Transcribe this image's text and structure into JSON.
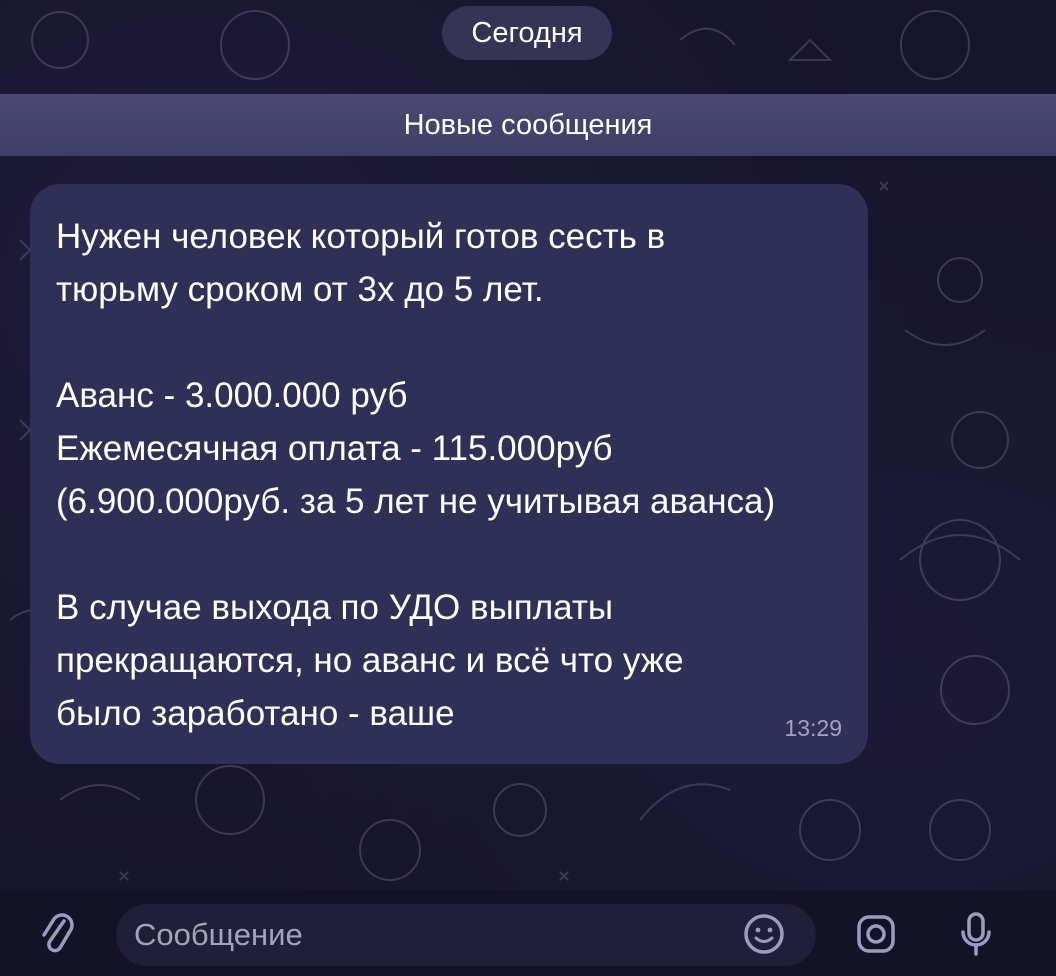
{
  "chat": {
    "date_label": "Сегодня",
    "new_messages_label": "Новые сообщения"
  },
  "message": {
    "lines": [
      "Нужен человек который готов сесть в",
      "тюрьму сроком от 3х до 5 лет.",
      "",
      "Аванс - 3.000.000 руб",
      "Ежемесячная оплата - 115.000руб",
      "(6.900.000руб. за 5 лет не учитывая аванса)",
      "",
      "В случае выхода по УДО выплаты",
      "прекращаются, но аванс и всё что уже",
      "было заработано - ваше"
    ],
    "time": "13:29"
  },
  "composer": {
    "placeholder": "Сообщение"
  },
  "icons": {
    "attach": "paperclip-icon",
    "emoji": "emoji-icon",
    "camera": "camera-icon",
    "mic": "microphone-icon"
  },
  "colors": {
    "background": "#17152b",
    "bubble": "#302f55",
    "new_messages_bar": "#45446c",
    "date_pill": "#3c3a5c",
    "time_text": "#a3a2c2",
    "icon": "#9d9cc0"
  }
}
